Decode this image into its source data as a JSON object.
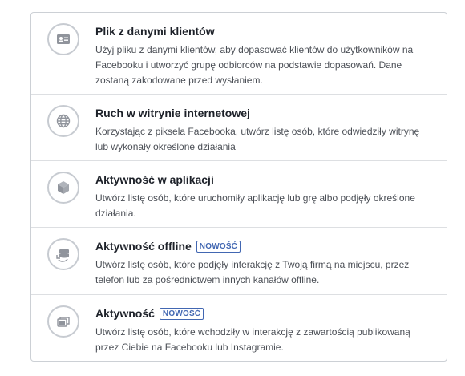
{
  "options": [
    {
      "title": "Plik z danymi klientów",
      "badge": "",
      "icon": "contact-card-icon",
      "description": "Użyj pliku z danymi klientów, aby dopasować klientów do użytkowników na Facebooku i utworzyć grupę odbiorców na podstawie dopasowań. Dane zostaną zakodowane przed wysłaniem."
    },
    {
      "title": "Ruch w witrynie internetowej",
      "badge": "",
      "icon": "globe-icon",
      "description": "Korzystając z piksela Facebooka, utwórz listę osób, które odwiedziły witrynę lub wykonały określone działania"
    },
    {
      "title": "Aktywność w aplikacji",
      "badge": "",
      "icon": "app-cube-icon",
      "description": "Utwórz listę osób, które uruchomiły aplikację lub grę albo podjęły określone działania."
    },
    {
      "title": "Aktywność offline",
      "badge": "NOWOŚĆ",
      "icon": "offline-sync-icon",
      "description": "Utwórz listę osób, które podjęły interakcję z Twoją firmą na miejscu, przez telefon lub za pośrednictwem innych kanałów offline."
    },
    {
      "title": "Aktywność",
      "badge": "NOWOŚĆ",
      "icon": "content-gallery-icon",
      "description": "Utwórz listę osób, które wchodziły w interakcję z zawartością publikowaną przez Ciebie na Facebooku lub Instagramie."
    }
  ],
  "colors": {
    "badge": "#4267b2",
    "icon": "#90949c",
    "border": "#ccd0d5"
  }
}
